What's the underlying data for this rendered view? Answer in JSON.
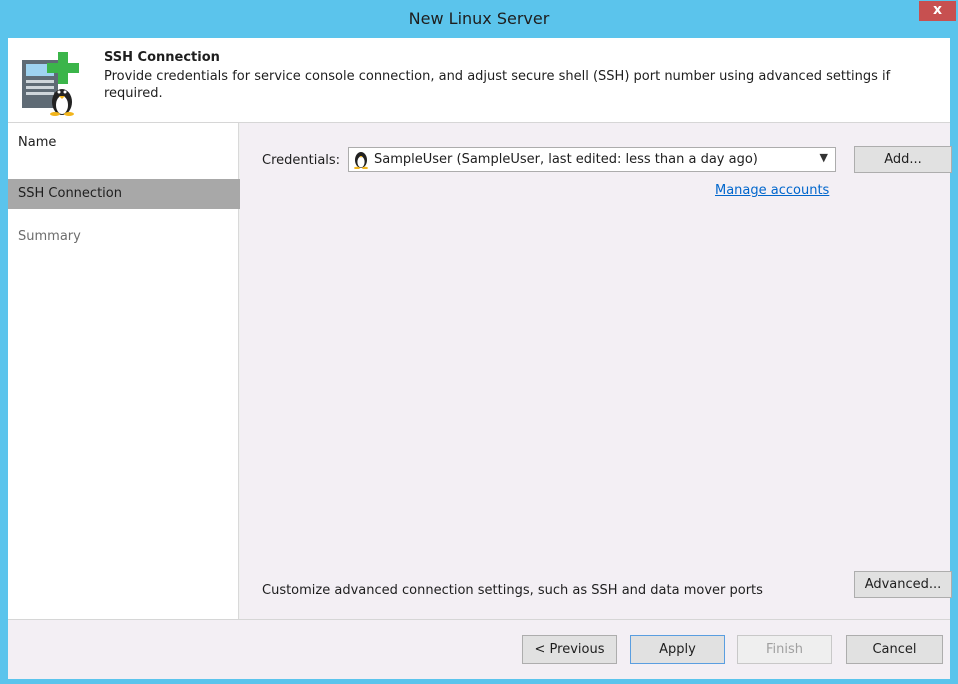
{
  "window": {
    "title": "New Linux Server",
    "close_glyph": "x"
  },
  "header": {
    "title": "SSH Connection",
    "description": "Provide credentials for service console connection, and adjust secure shell (SSH) port number using advanced settings if required."
  },
  "nav": {
    "items": [
      {
        "label": "Name",
        "state": "normal"
      },
      {
        "label": "SSH Connection",
        "state": "active"
      },
      {
        "label": "Summary",
        "state": "inactive"
      }
    ]
  },
  "credentials": {
    "label": "Credentials:",
    "selected": "SampleUser (SampleUser, last edited: less than a day ago)",
    "add_label": "Add...",
    "manage_link": "Manage accounts"
  },
  "advanced": {
    "text": "Customize advanced connection settings, such as SSH and data mover ports",
    "button_label": "Advanced..."
  },
  "footer": {
    "previous_label": "< Previous",
    "apply_label": "Apply",
    "finish_label": "Finish",
    "cancel_label": "Cancel"
  },
  "colors": {
    "title_bar": "#5bc4ec",
    "active_nav": "#a8a8a8",
    "link": "#0066cc",
    "close": "#c75050"
  }
}
